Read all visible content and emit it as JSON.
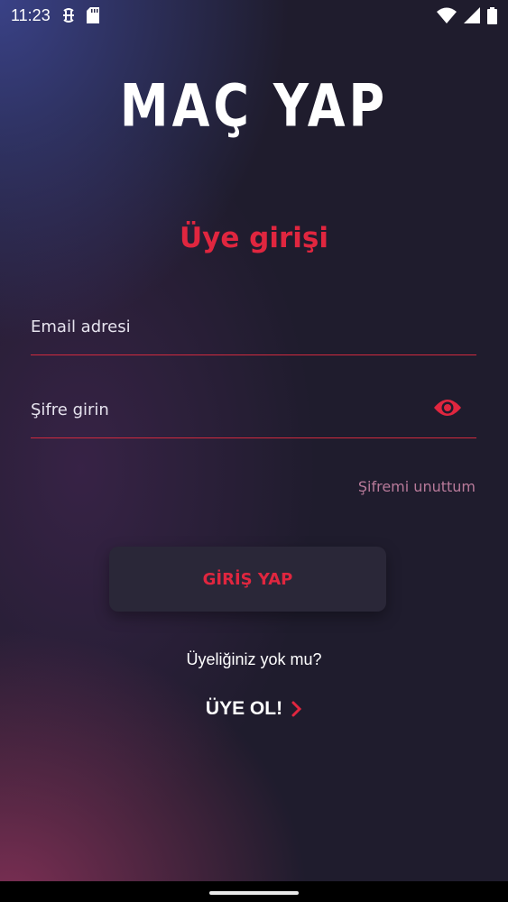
{
  "status_bar": {
    "time": "11:23",
    "icons": [
      "dev-sync-icon",
      "sd-card-icon",
      "wifi-icon",
      "signal-icon",
      "battery-icon"
    ]
  },
  "logo": {
    "text": "MAÇ YAP"
  },
  "title": "Üye girişi",
  "email": {
    "placeholder": "Email adresi",
    "value": ""
  },
  "password": {
    "placeholder": "Şifre girin",
    "value": "",
    "toggle_icon": "eye-icon"
  },
  "forgot_password": "Şifremi unuttum",
  "login_button": "GİRİŞ YAP",
  "no_account_text": "Üyeliğiniz yok mu?",
  "signup": {
    "label": "ÜYE OL!",
    "icon": "chevron-right-icon"
  },
  "colors": {
    "accent": "#e0263f",
    "muted_link": "#b87a9a",
    "button_bg": "#2a2738"
  }
}
